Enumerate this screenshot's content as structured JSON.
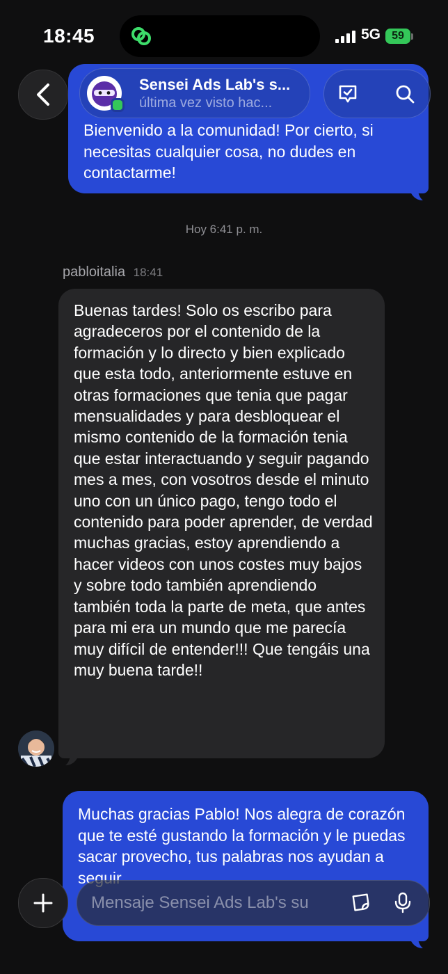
{
  "status_bar": {
    "time": "18:45",
    "network": "5G",
    "battery": "59"
  },
  "header": {
    "chat_name": "Sensei Ads Lab's s...",
    "chat_subtitle": "última vez visto hac..."
  },
  "messages": {
    "welcome_text": "Bienvenido a la comunidad! Por cierto, si necesitas cualquier cosa, no dudes en contactarme!",
    "day_separator": "Hoy 6:41 p. m.",
    "incoming_sender": "pabloitalia",
    "incoming_time": "18:41",
    "incoming_text": "Buenas tardes! Solo os escribo para agradeceros por el contenido de la formación y lo directo y bien explicado que esta todo, anteriormente estuve en otras formaciones que tenia que pagar mensualidades y para desbloquear el mismo contenido de la formación tenia que estar interactuando y seguir pagando mes a mes, con vosotros desde el minuto uno con un único pago, tengo todo el contenido para poder aprender, de verdad muchas gracias, estoy aprendiendo a hacer videos con unos costes muy bajos y sobre todo también aprendiendo también toda la parte de meta, que antes para mi era un mundo que me parecía muy difícil de entender!!! Que tengáis una muy buena tarde!!",
    "reply_text": "Muchas gracias Pablo! Nos alegra de corazón que te esté gustando la formación y le puedas sacar provecho, tus palabras nos ayudan a seguir"
  },
  "composer": {
    "placeholder": "Mensaje Sensei Ads Lab's su"
  },
  "colors": {
    "outgoing_bubble": "#2849d6",
    "incoming_bubble": "#262628",
    "online": "#34c759"
  }
}
